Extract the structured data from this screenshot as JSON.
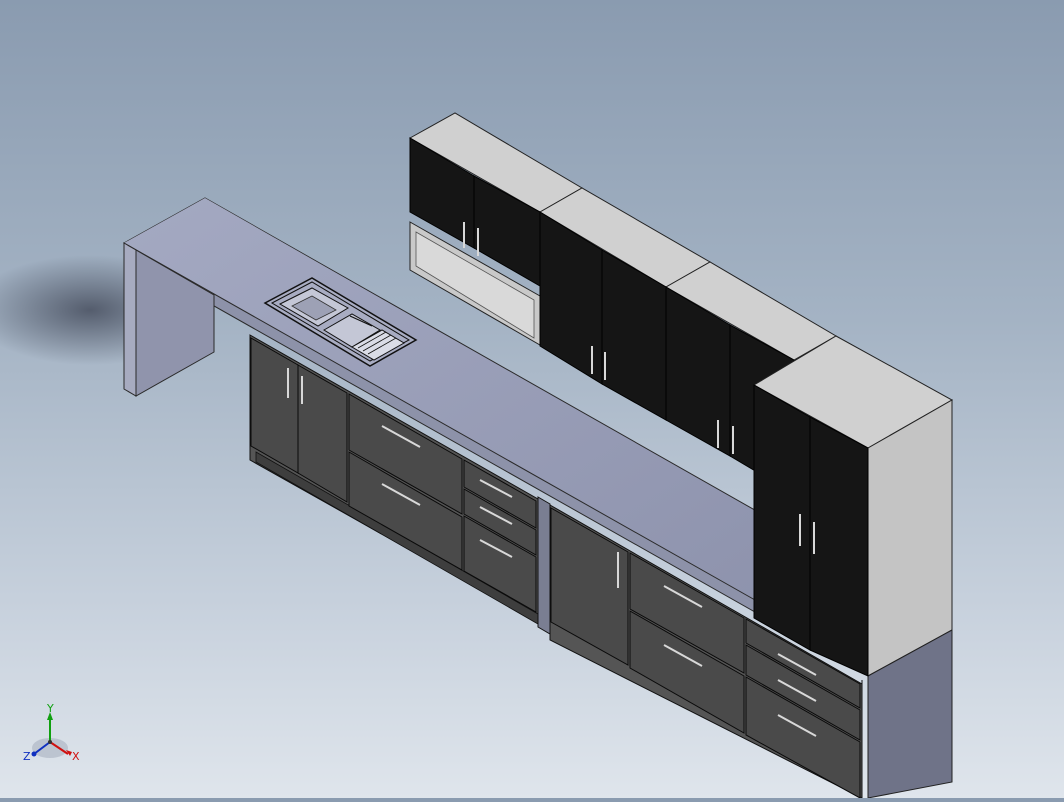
{
  "viewport": {
    "background_top": "#8a9bb0",
    "background_bottom": "#dfe5ec"
  },
  "triad": {
    "x_label": "X",
    "y_label": "Y",
    "z_label": "Z",
    "x_color": "#d01010",
    "y_color": "#10a010",
    "z_color": "#1030c0"
  },
  "model": {
    "countertop_color": "#9aa0b8",
    "base_cabinet_color": "#4a4a4a",
    "wall_cabinet_color": "#151515",
    "cabinet_side_color": "#c8c8c8",
    "handle_color": "#d8d8d8"
  }
}
